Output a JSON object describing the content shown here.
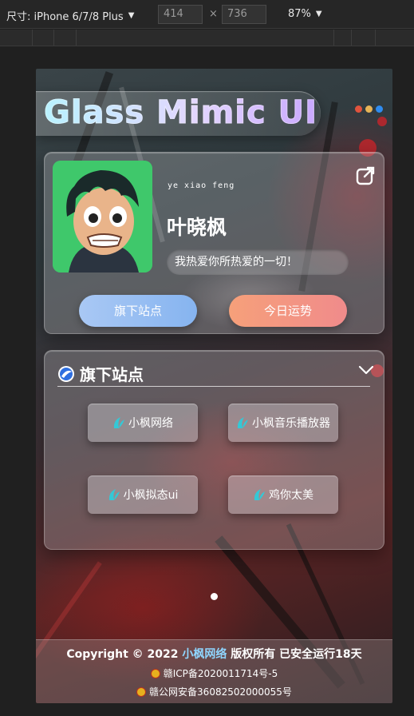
{
  "devtools": {
    "device_label": "尺寸: iPhone 6/7/8 Plus",
    "width": "414",
    "height": "736",
    "times": "×",
    "zoom": "87%"
  },
  "header": {
    "title": "Glass Mimic UI",
    "window_dots": [
      "#e0533d",
      "#e8b457",
      "#2f8cf0"
    ]
  },
  "profile": {
    "handle": "ye xiao feng",
    "name": "叶晓枫",
    "motto": "我热爱你所热爱的一切！",
    "btn_sites": "旗下站点",
    "btn_fortune": "今日运势"
  },
  "sites": {
    "title": "旗下站点",
    "items": [
      {
        "label": "小枫网络"
      },
      {
        "label": "小枫音乐播放器"
      },
      {
        "label": "小枫拟态ui"
      },
      {
        "label": "鸡你太美"
      }
    ]
  },
  "footer": {
    "copyright_prefix": "Copyright © 2022 ",
    "brand": "小枫网络",
    "copyright_suffix": " 版权所有 已安全运行18天",
    "icp": "赣ICP备2020011714号-5",
    "police": "赣公网安备36082502000055号"
  }
}
